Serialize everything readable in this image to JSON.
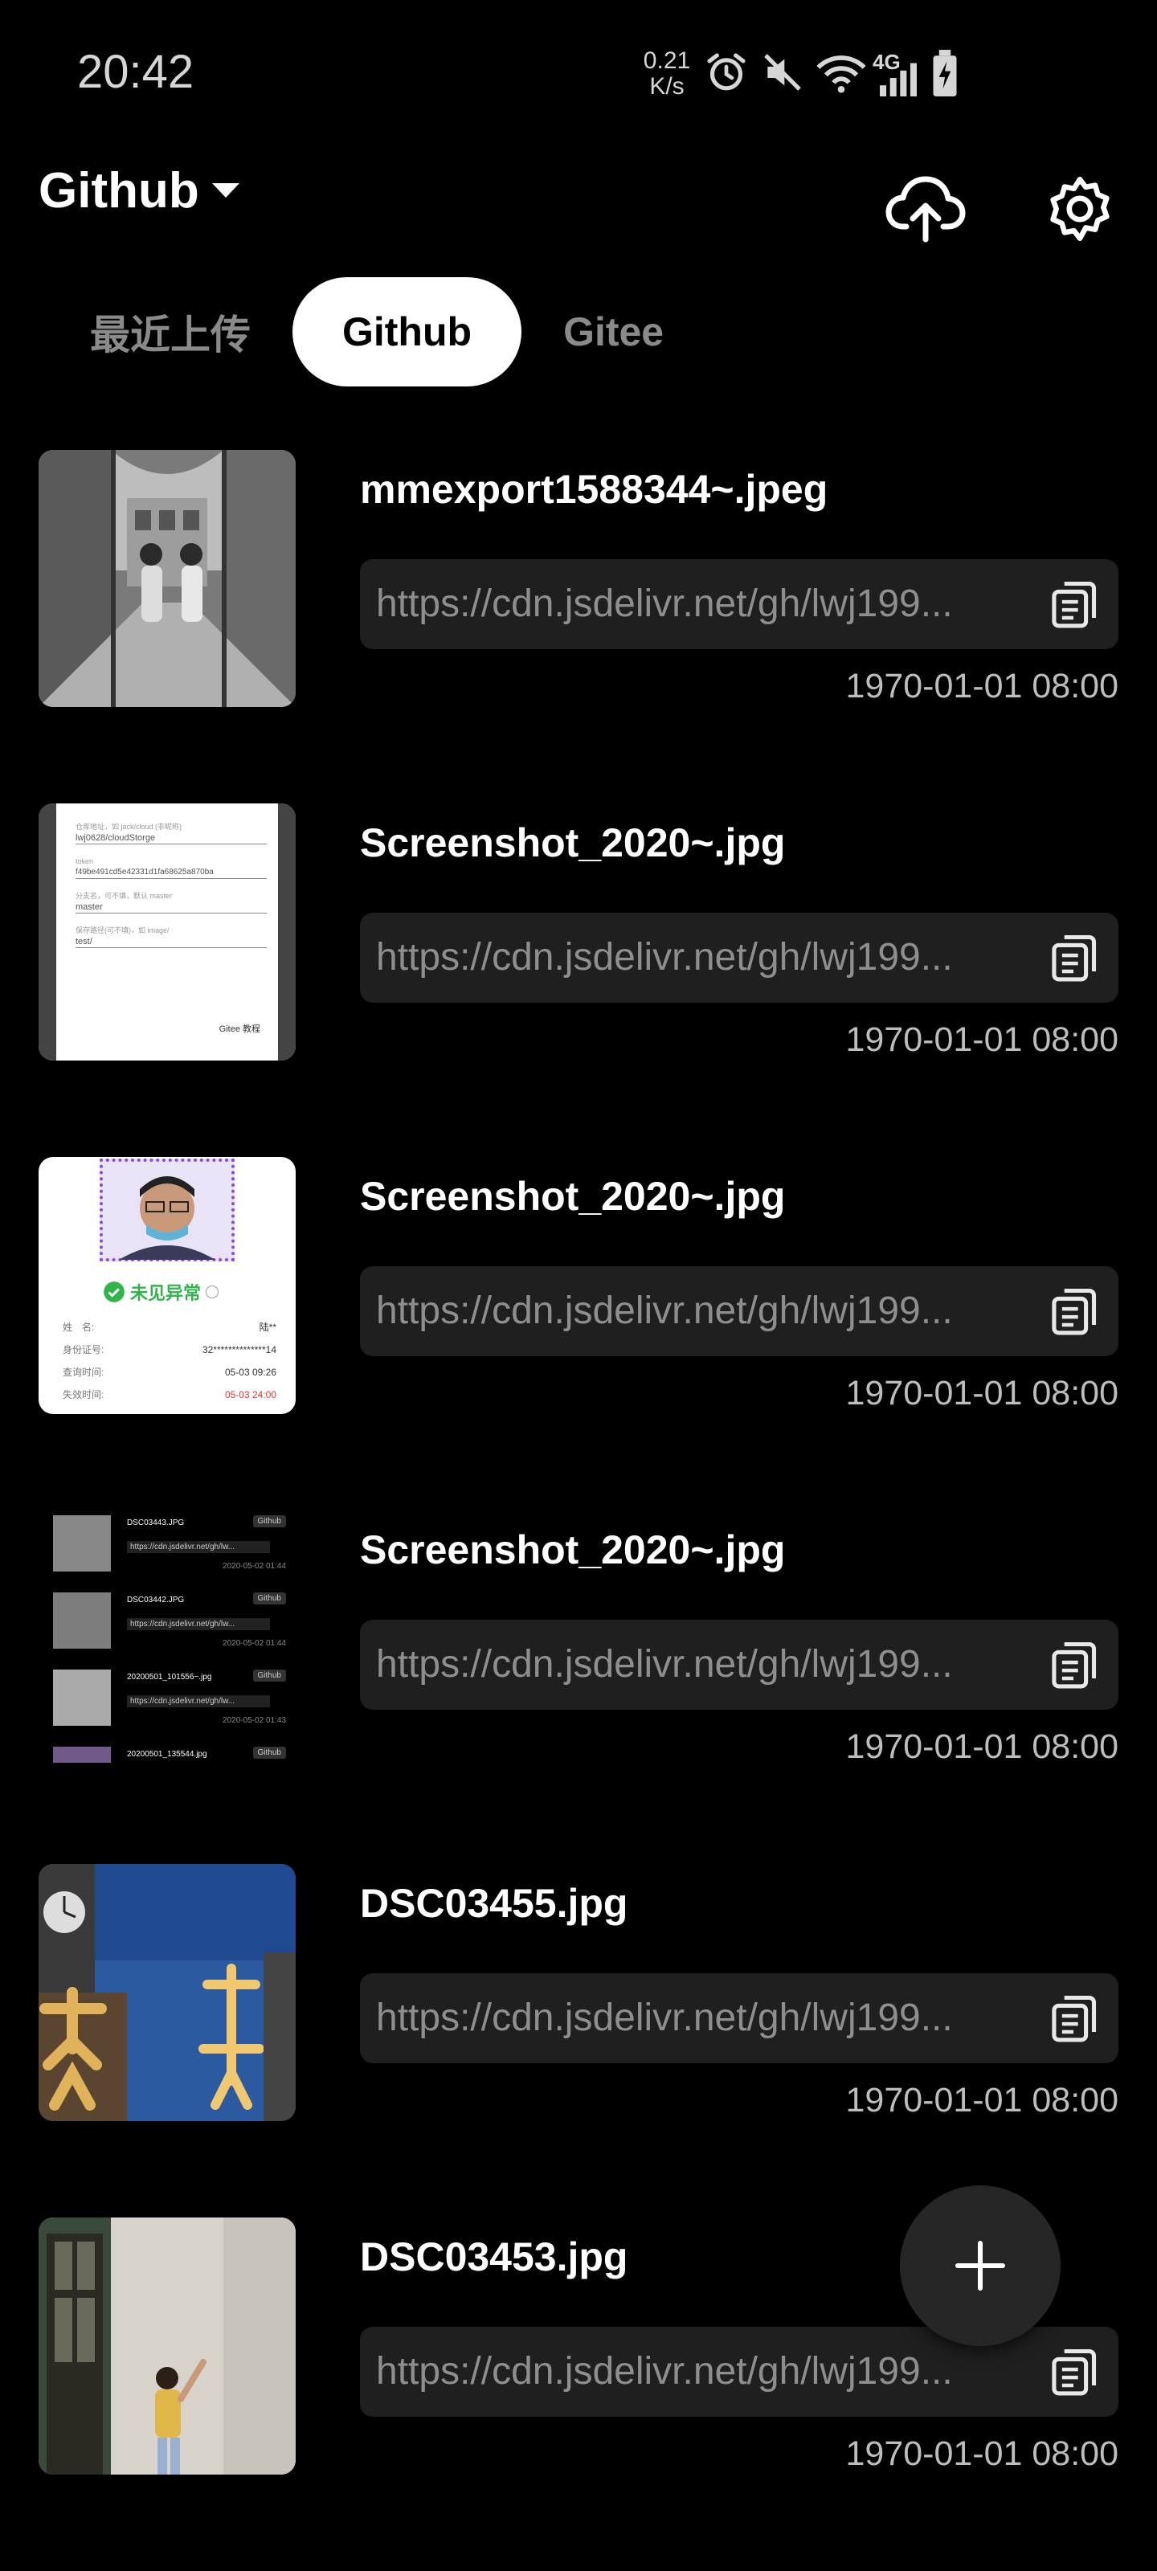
{
  "status_bar": {
    "time": "20:42",
    "speed_value": "0.21",
    "speed_unit": "K/s",
    "network": "4G"
  },
  "app_bar": {
    "account_label": "Github"
  },
  "tabs": [
    {
      "label": "最近上传",
      "active": false
    },
    {
      "label": "Github",
      "active": true
    },
    {
      "label": "Gitee",
      "active": false
    }
  ],
  "items": [
    {
      "filename": "mmexport1588344~.jpeg",
      "url": "https://cdn.jsdelivr.net/gh/lwj199...",
      "date": "1970-01-01 08:00"
    },
    {
      "filename": "Screenshot_2020~.jpg",
      "url": "https://cdn.jsdelivr.net/gh/lwj199...",
      "date": "1970-01-01 08:00"
    },
    {
      "filename": "Screenshot_2020~.jpg",
      "url": "https://cdn.jsdelivr.net/gh/lwj199...",
      "date": "1970-01-01 08:00"
    },
    {
      "filename": "Screenshot_2020~.jpg",
      "url": "https://cdn.jsdelivr.net/gh/lwj199...",
      "date": "1970-01-01 08:00"
    },
    {
      "filename": "DSC03455.jpg",
      "url": "https://cdn.jsdelivr.net/gh/lwj199...",
      "date": "1970-01-01 08:00"
    },
    {
      "filename": "DSC03453.jpg",
      "url": "https://cdn.jsdelivr.net/gh/lwj199...",
      "date": "1970-01-01 08:00"
    }
  ],
  "thumb_text": {
    "settings_form": {
      "repo_hint": "仓库地址，如 jack/cloud (非昵称)",
      "repo_value": "lwj0628/cloudStorge",
      "token_hint": "token",
      "token_value": "f49be491cd5e42331d1fa68625a870ba",
      "branch_hint": "分支名，可不填，默认 master",
      "branch_value": "master",
      "path_hint": "保存路径(可不填)，如 image/",
      "path_value": "test/",
      "link": "Gitee 教程"
    },
    "health_code": {
      "status": "未见异常",
      "rows": [
        {
          "label": "姓　名:",
          "value": "陆**"
        },
        {
          "label": "身份证号:",
          "value": "32**************14"
        },
        {
          "label": "查询时间:",
          "value": "05-03 09:26"
        },
        {
          "label": "失效时间:",
          "value": "05-03 24:00"
        }
      ]
    },
    "list_preview": [
      {
        "name": "DSC03443.JPG",
        "badge": "Github",
        "url": "https://cdn.jsdelivr.net/gh/lw...",
        "date": "2020-05-02 01:44"
      },
      {
        "name": "DSC03442.JPG",
        "badge": "Github",
        "url": "https://cdn.jsdelivr.net/gh/lw...",
        "date": "2020-05-02 01:44"
      },
      {
        "name": "20200501_101556~.jpg",
        "badge": "Github",
        "url": "https://cdn.jsdelivr.net/gh/lw...",
        "date": "2020-05-02 01:43"
      },
      {
        "name": "20200501_135544.jpg",
        "badge": "Github",
        "url": "",
        "date": ""
      }
    ]
  },
  "icons": {
    "dropdown": "caret-down-icon",
    "upload": "cloud-upload-icon",
    "settings": "gear-icon",
    "copy": "copy-icon",
    "fab": "plus-icon"
  },
  "colors": {
    "background": "#000000",
    "url_box": "#1f1f1f",
    "tab_active_bg": "#ffffff",
    "fab": "#262626"
  }
}
